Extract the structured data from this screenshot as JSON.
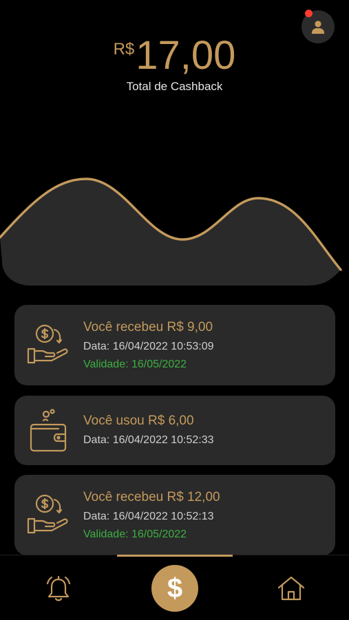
{
  "header": {
    "currency": "R$",
    "amount": "17,00",
    "label": "Total de Cashback"
  },
  "colors": {
    "accent": "#c49a5c",
    "background": "#000000",
    "card": "#2a2a2a",
    "validity": "#3cb043",
    "notification": "#ff3b30"
  },
  "transactions": [
    {
      "icon": "cashback-received-icon",
      "title": "Você recebeu R$ 9,00",
      "date": "Data: 16/04/2022 10:53:09",
      "validity": "Validade: 16/05/2022"
    },
    {
      "icon": "wallet-icon",
      "title": "Você usou R$ 6,00",
      "date": "Data: 16/04/2022 10:52:33"
    },
    {
      "icon": "cashback-received-icon",
      "title": "Você recebeu R$ 12,00",
      "date": "Data: 16/04/2022 10:52:13",
      "validity": "Validade: 16/05/2022"
    }
  ],
  "nav": {
    "center_symbol": "$",
    "items": [
      "bell-icon",
      "dollar-icon",
      "home-icon"
    ]
  }
}
